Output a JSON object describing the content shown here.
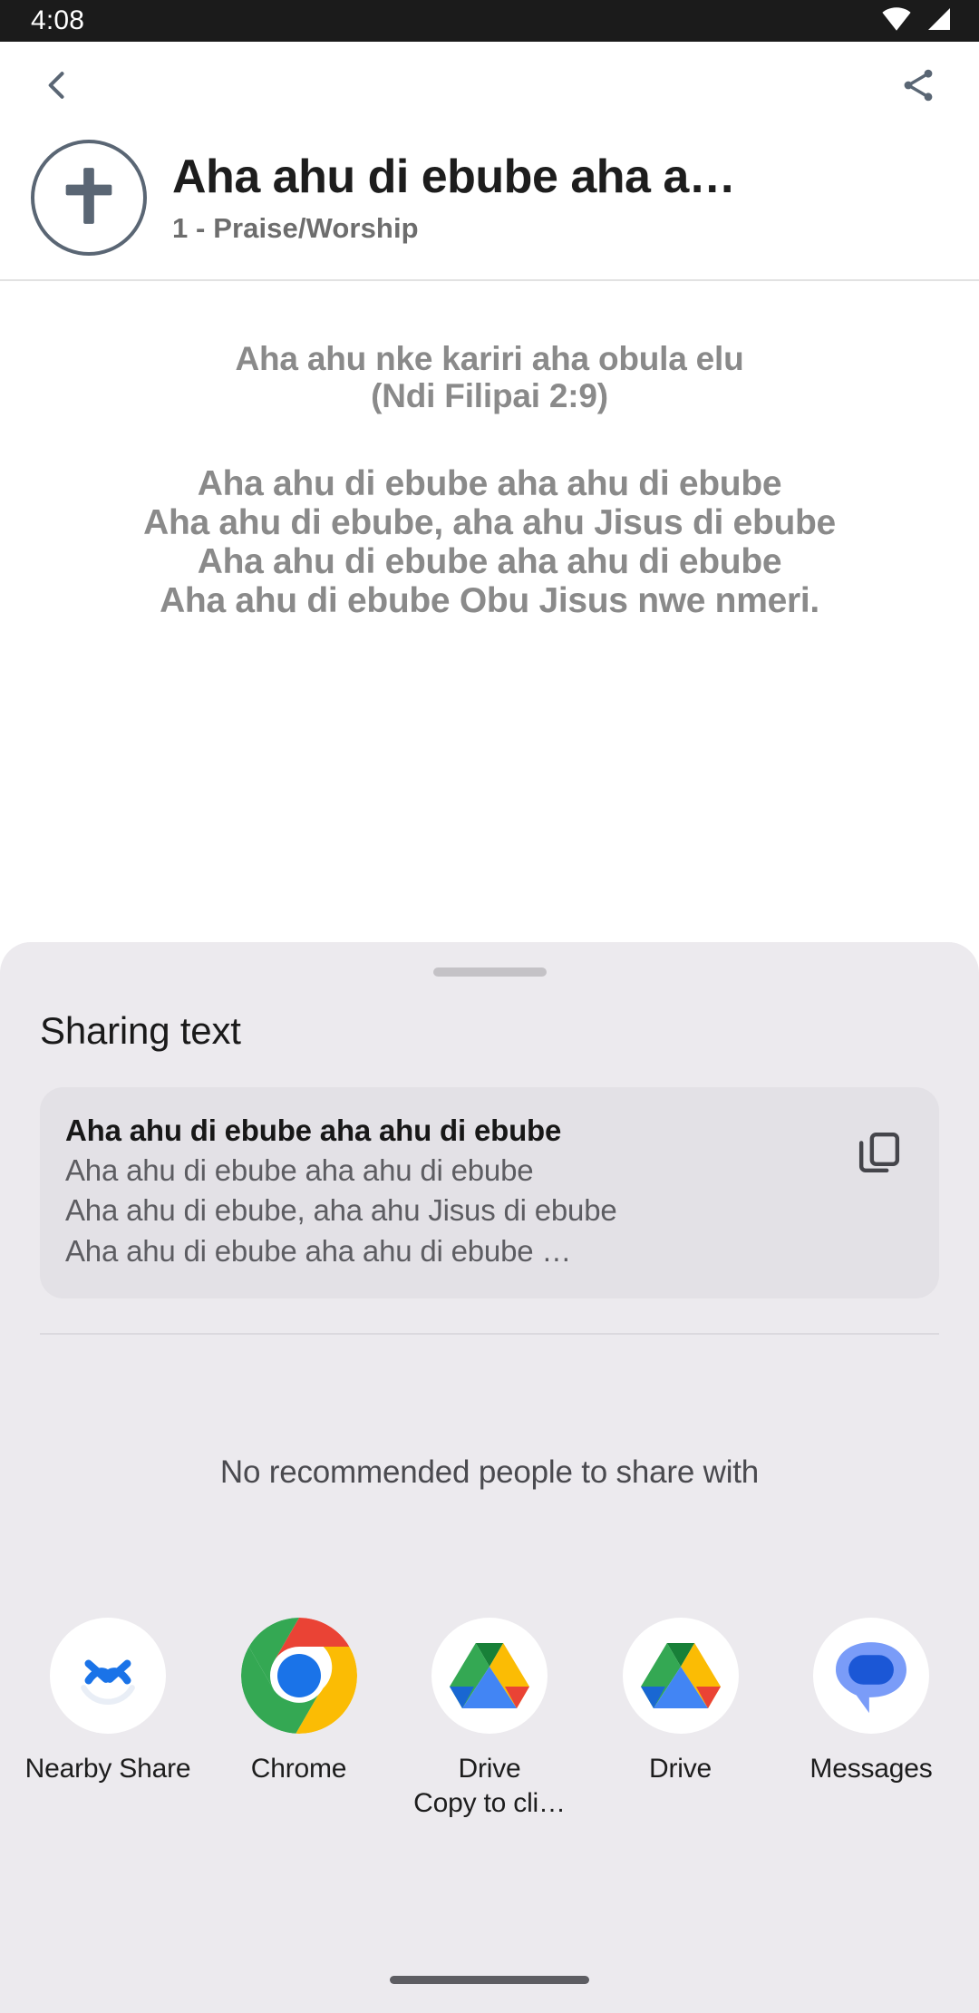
{
  "status_bar": {
    "time": "4:08",
    "icons": [
      "wifi-icon",
      "cell-signal-icon"
    ]
  },
  "app_bar": {
    "back_icon": "back-chevron-icon",
    "share_icon": "share-icon"
  },
  "song_header": {
    "avatar_icon": "cross-in-circle-icon",
    "title": "Aha ahu di ebube aha a…",
    "subtitle": "1 - Praise/Worship"
  },
  "lyrics": {
    "intro": [
      "Aha ahu nke kariri aha obula elu",
      "(Ndi Filipai 2:9)"
    ],
    "verse": [
      "Aha ahu di ebube aha ahu di ebube",
      "Aha ahu di ebube, aha ahu Jisus di ebube",
      "Aha ahu di ebube aha ahu di ebube",
      "Aha ahu di ebube Obu Jisus nwe nmeri."
    ]
  },
  "share_sheet": {
    "title": "Sharing text",
    "preview": {
      "title": "Aha ahu di ebube aha ahu di ebube",
      "lines": [
        "Aha ahu di ebube aha ahu di ebube",
        "Aha ahu di ebube, aha ahu Jisus di ebube",
        "Aha ahu di ebube aha ahu di ebube …"
      ],
      "copy_icon": "copy-icon"
    },
    "empty_recommendations": "No recommended people to share with",
    "apps": [
      {
        "name": "Nearby Share",
        "sub": "",
        "icon": "nearby-share-icon"
      },
      {
        "name": "Chrome",
        "sub": "",
        "icon": "chrome-icon"
      },
      {
        "name": "Drive",
        "sub": "Copy to cli…",
        "icon": "google-drive-icon"
      },
      {
        "name": "Drive",
        "sub": "",
        "icon": "google-drive-icon"
      },
      {
        "name": "Messages",
        "sub": "",
        "icon": "google-messages-icon"
      }
    ]
  },
  "nav_bar": {
    "handle": "home-gesture-pill"
  },
  "colors": {
    "status_bar_bg": "#1b1b1b",
    "sheet_bg": "#eceaee",
    "preview_bg": "#e3e1e6",
    "lyric_text": "#8a8a8a",
    "avatar_stroke": "#5a6674",
    "chrome_blue": "#1a73e8",
    "chrome_red": "#ea4335",
    "chrome_yellow": "#fbbc04",
    "chrome_green": "#34a853"
  }
}
